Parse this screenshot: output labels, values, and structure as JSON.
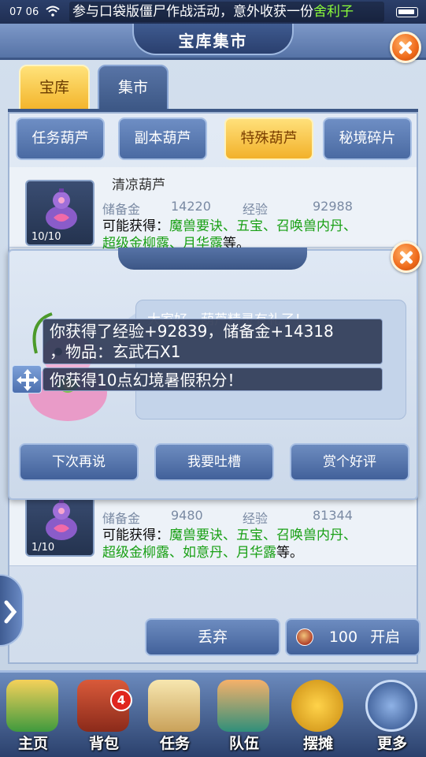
{
  "status_bar": {
    "time": "07 06",
    "marquee_prefix": "参与口袋版僵尸作战活动，意外收获一份",
    "marquee_highlight": "舍利子"
  },
  "header": {
    "title": "宝库集市"
  },
  "main_tabs": [
    {
      "label": "宝库"
    },
    {
      "label": "集市"
    }
  ],
  "sub_tabs": [
    {
      "label": "任务葫芦"
    },
    {
      "label": "副本葫芦"
    },
    {
      "label": "特殊葫芦"
    },
    {
      "label": "秘境碎片"
    }
  ],
  "items": [
    {
      "name": "清凉葫芦",
      "count": "10/10",
      "reserve_label": "储备金",
      "reserve_value": "14220",
      "exp_label": "经验",
      "exp_value": "92988",
      "reward_prefix": "可能获得：",
      "reward_line1": "魔兽要诀、五宝、召唤兽内丹、",
      "reward_line2": "超级金柳露、月华露",
      "reward_suffix": "等。"
    },
    {
      "count": "1/10",
      "reserve_label": "储备金",
      "reserve_value": "9480",
      "exp_label": "经验",
      "exp_value": "81344",
      "reward_prefix": "可能获得：",
      "reward_line1": "魔兽要诀、五宝、召唤兽内丹、",
      "reward_line2": "超级金柳露、如意丹、月华露",
      "reward_suffix": "等。"
    }
  ],
  "dialog": {
    "speech": "大家好，葫芦精灵有礼了！",
    "buttons": [
      {
        "label": "下次再说"
      },
      {
        "label": "我要吐槽"
      },
      {
        "label": "赏个好评"
      }
    ]
  },
  "toasts": {
    "line1": "你获得了经验+92839，储备金+14318",
    "line2": "，物品：玄武石X1",
    "line3": "你获得10点幻境暑假积分！"
  },
  "actions": {
    "discard_label": "丢弃",
    "open_cost": "100",
    "open_label": "开启"
  },
  "bottom_nav": [
    {
      "label": "主页"
    },
    {
      "label": "背包",
      "badge": "4"
    },
    {
      "label": "任务"
    },
    {
      "label": "队伍"
    },
    {
      "label": "摆摊"
    },
    {
      "label": "更多"
    }
  ],
  "colors": {
    "accent_gold": "#f2b12a",
    "panel_blue": "#4a6aa2",
    "reward_green": "#19a015",
    "close_orange": "#ef6a1a"
  }
}
